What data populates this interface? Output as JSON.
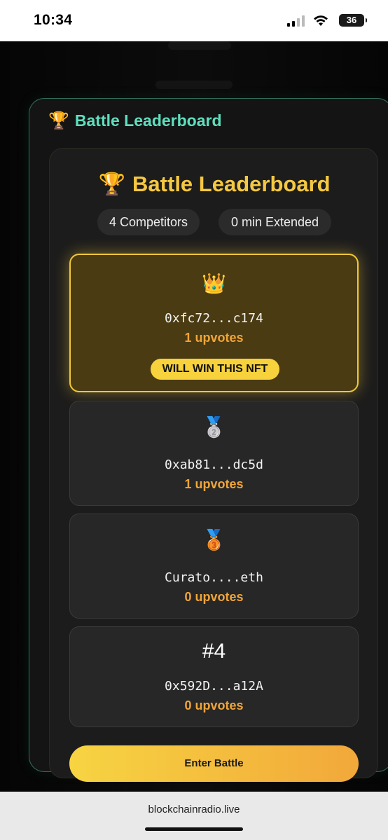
{
  "status_bar": {
    "time": "10:34",
    "battery": "36"
  },
  "outer_card": {
    "title": "Battle Leaderboard",
    "icon": "trophy-icon"
  },
  "leaderboard": {
    "title": "Battle Leaderboard",
    "competitors": "4 Competitors",
    "extended": "0 min Extended",
    "entries": [
      {
        "medal": "👑",
        "address": "0xfc72...c174",
        "votes": "1 upvotes",
        "badge": "WILL WIN THIS NFT"
      },
      {
        "medal": "🥈",
        "address": "0xab81...dc5d",
        "votes": "1 upvotes"
      },
      {
        "medal": "🥉",
        "address": "Curato....eth",
        "votes": "0 upvotes"
      },
      {
        "rank": "#4",
        "address": "0x592D...a12A",
        "votes": "0 upvotes"
      }
    ],
    "enter_button": "Enter Battle"
  },
  "browser": {
    "url": "blockchainradio.live"
  },
  "colors": {
    "accent_teal": "#5ee0bf",
    "gold": "#f5c842",
    "votes_orange": "#f0a53a"
  }
}
